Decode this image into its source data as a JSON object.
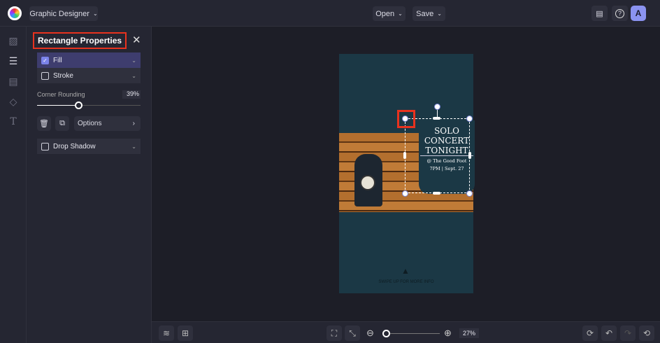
{
  "header": {
    "project_name": "Graphic Designer",
    "open_label": "Open",
    "save_label": "Save",
    "avatar_initial": "A"
  },
  "panel": {
    "title": "Rectangle Properties",
    "fill_label": "Fill",
    "stroke_label": "Stroke",
    "corner_rounding_label": "Corner Rounding",
    "corner_rounding_value": "39%",
    "corner_rounding_fraction": 0.39,
    "options_label": "Options",
    "drop_shadow_label": "Drop Shadow"
  },
  "design": {
    "headline_1": "SOLO",
    "headline_2": "CONCERT",
    "headline_3": "TONIGHT",
    "venue": "@ The Good Foot",
    "time": "7PM | Sept. 27",
    "cta": "SWIPE UP FOR MORE INFO"
  },
  "footer": {
    "zoom_value": "27%"
  },
  "colors": {
    "accent": "#5b63d6",
    "highlight": "#e8321e",
    "doc_bg": "#1b3845"
  }
}
